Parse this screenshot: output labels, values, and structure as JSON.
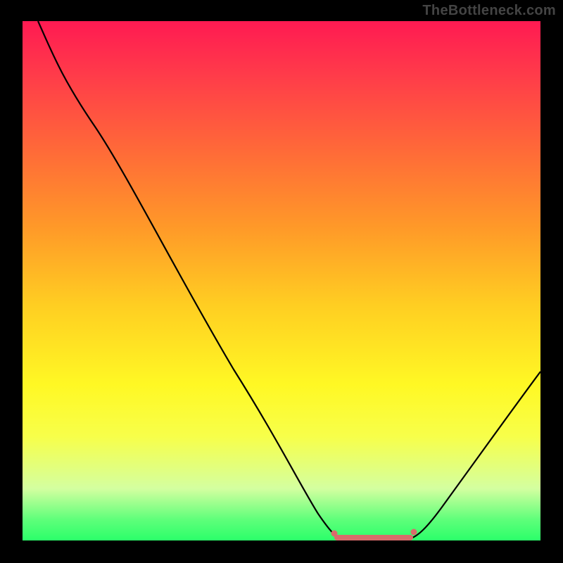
{
  "watermark": "TheBottleneck.com",
  "colors": {
    "gradient_top": "#ff1a52",
    "gradient_bottom": "#2bff6a",
    "curve": "#000000",
    "marker": "#d96b6b",
    "background": "#000000"
  },
  "chart_data": {
    "type": "line",
    "title": "",
    "xlabel": "",
    "ylabel": "",
    "xlim": [
      0,
      100
    ],
    "ylim": [
      0,
      100
    ],
    "grid": false,
    "x": [
      3,
      7,
      14,
      24,
      36,
      48,
      55,
      58,
      60,
      64,
      70,
      74,
      76,
      80,
      86,
      94,
      100
    ],
    "values": [
      100,
      93,
      80,
      63,
      44,
      24,
      11,
      5,
      2,
      0,
      0,
      0,
      2,
      6,
      13,
      24,
      33
    ],
    "optimal_range_x": [
      60,
      75
    ],
    "optimal_value": 0,
    "annotations": []
  }
}
